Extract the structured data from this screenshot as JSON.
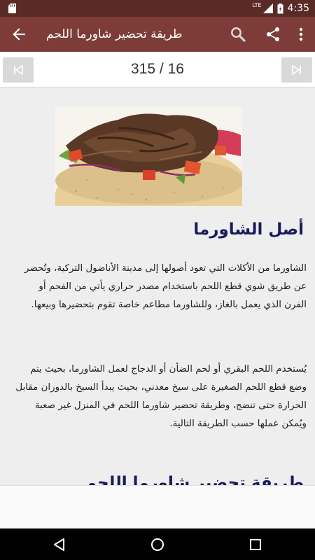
{
  "status_bar": {
    "network": "LTE",
    "time": "4:35"
  },
  "app_bar": {
    "title": "طريقة تحضير شاورما اللحم",
    "back_icon": "arrow-back-icon",
    "search_icon": "search-icon",
    "share_icon": "share-icon",
    "more_icon": "more-vert-icon"
  },
  "pager": {
    "page_counter": "315 / 16",
    "first_icon": "skip-first-icon",
    "last_icon": "skip-last-icon"
  },
  "article": {
    "image": "shawarma-photo",
    "heading": "أصل الشاورما",
    "paragraphs": [
      "الشاورما من الأكلات التي تعود أصولها إلى مدينة الأناضول التركية، وتُحضر عن طريق شوي قطع اللحم باستخدام مصدر حراري يأتي من الفحم أو الفرن الذي يعمل بالغاز، وللشاورما مطاعم خاصة تقوم بتحضيرها وبيعها.",
      "يُستخدم اللحم البقري أو لحم الضأن أو الدجاج لعمل الشاورما، بحيث يتم وضع قطع اللحم الصغيرة على سيخ معدني، بحيث يبدأ السيخ بالدوران مقابل الحرارة حتى تنضج، وطريقة تحضير شاورما اللحم في المنزل غير صعبة ويُمكن عملها حسب الطريقة التالية."
    ],
    "next_heading": "طريقة تحضير شاورما اللحم"
  },
  "colors": {
    "status_bar": "#5a2a27",
    "app_bar": "#7d3c38",
    "heading": "#1a1a60",
    "content_bg": "#eeeeee"
  }
}
